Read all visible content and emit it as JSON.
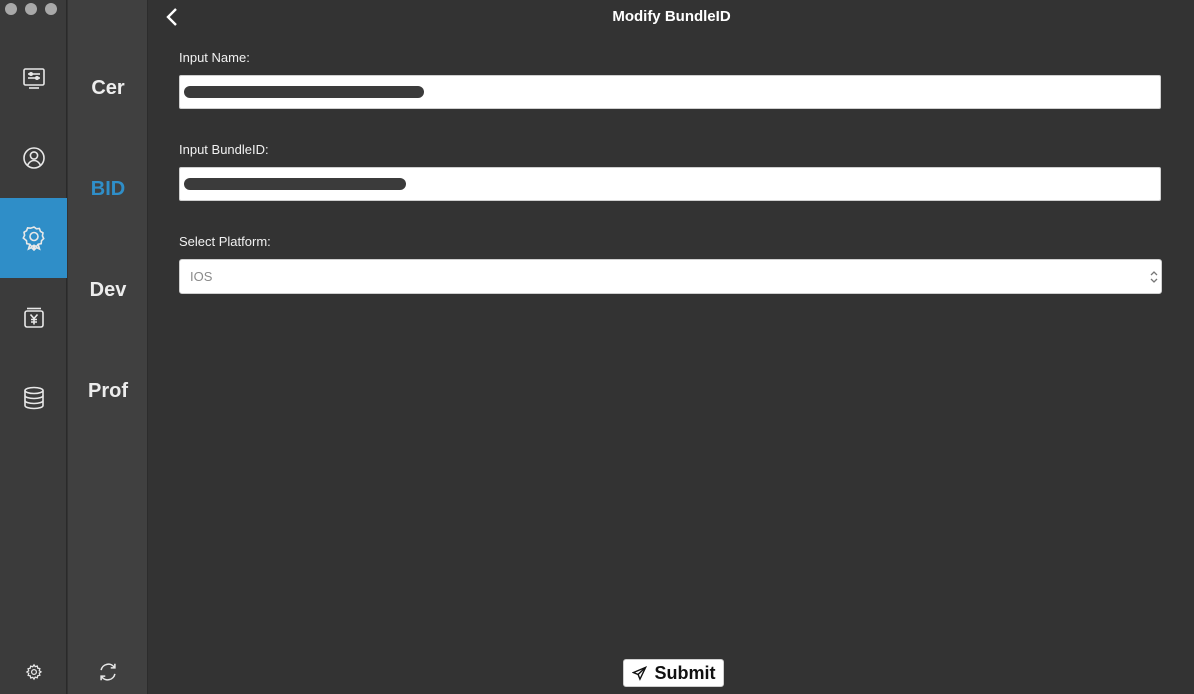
{
  "window": {
    "traffic_lights": [
      "close",
      "minimize",
      "zoom"
    ]
  },
  "rail": {
    "items": [
      {
        "icon": "dashboard-icon",
        "active": false
      },
      {
        "icon": "user-icon",
        "active": false
      },
      {
        "icon": "badge-icon",
        "active": true
      },
      {
        "icon": "yen-wallet-icon",
        "active": false
      },
      {
        "icon": "database-icon",
        "active": false
      }
    ],
    "footer_icon": "gear-icon",
    "accent_color": "#2f8ec8"
  },
  "subnav": {
    "items": [
      {
        "label": "Cer",
        "active": false
      },
      {
        "label": "BID",
        "active": true
      },
      {
        "label": "Dev",
        "active": false
      },
      {
        "label": "Prof",
        "active": false
      }
    ],
    "footer_icon": "refresh-icon"
  },
  "header": {
    "back_icon": "chevron-left-icon",
    "title": "Modify BundleID"
  },
  "form": {
    "name_label": "Input Name:",
    "name_value": "",
    "bundle_label": "Input BundleID:",
    "bundle_value": "",
    "platform_label": "Select Platform:",
    "platform_value": "IOS"
  },
  "footer": {
    "submit_icon": "send-icon",
    "submit_label": "Submit"
  }
}
